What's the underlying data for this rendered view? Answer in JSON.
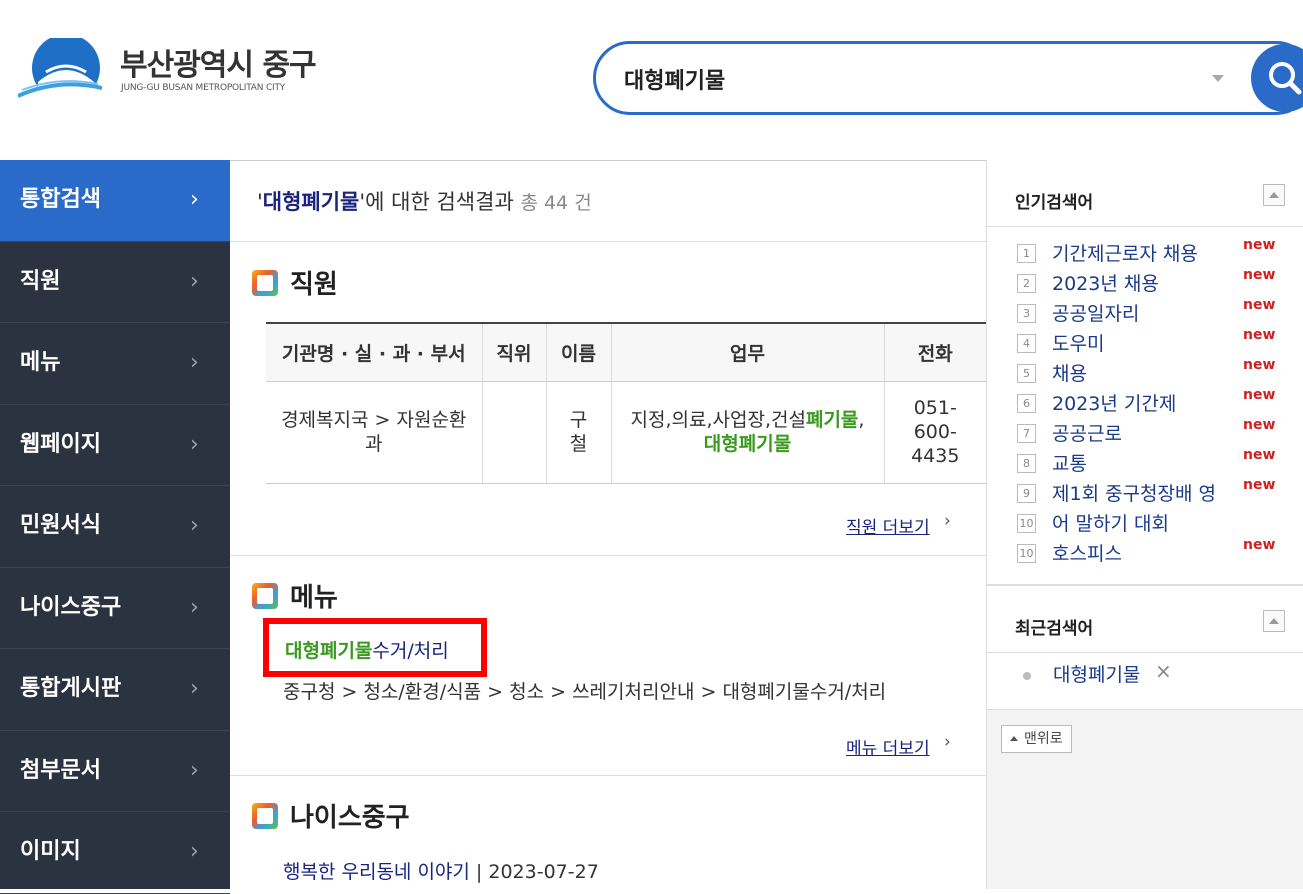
{
  "header": {
    "logo_title": "부산광역시 중구",
    "logo_subtitle": "JUNG-GU BUSAN METROPOLITAN CITY",
    "search_value": "대형폐기물",
    "search_icon": "search-icon"
  },
  "sidebar": {
    "items": [
      {
        "label": "통합검색",
        "active": true
      },
      {
        "label": "직원"
      },
      {
        "label": "메뉴"
      },
      {
        "label": "웹페이지"
      },
      {
        "label": "민원서식"
      },
      {
        "label": "나이스중구"
      },
      {
        "label": "통합게시판"
      },
      {
        "label": "첨부문서"
      },
      {
        "label": "이미지"
      }
    ],
    "chevron": "›"
  },
  "results": {
    "quote_open": "'",
    "keyword": "대형폐기물",
    "quote_close": "'",
    "suffix": "에 대한 검색결과",
    "count": "총 44 건"
  },
  "staff": {
    "title": "직원",
    "headers": [
      "기관명 · 실 · 과 · 부서",
      "직위",
      "이름",
      "업무",
      "전화"
    ],
    "row": {
      "dept": "경제복지국 > 자원순환과",
      "position": "",
      "name": "구철",
      "duty_plain": "지정,의료,사업장,건설",
      "duty_hl1": "폐기물",
      "duty_sep": ",",
      "duty_hl2": "대형폐기물",
      "phone": "051-600-4435"
    },
    "more": "직원 더보기"
  },
  "menu": {
    "title": "메뉴",
    "link_hl": "대형폐기물",
    "link_rest": "수거/처리",
    "path": "중구청 > 청소/환경/식품 > 청소 > 쓰레기처리안내 > 대형폐기물수거/처리",
    "more": "메뉴 더보기"
  },
  "nice": {
    "title": "나이스중구",
    "link": "행복한 우리동네 이야기",
    "sep": " | ",
    "date": "2023-07-27"
  },
  "popular": {
    "title": "인기검색어",
    "items": [
      {
        "num": "1",
        "text": "기간제근로자 채용",
        "badge": "new"
      },
      {
        "num": "2",
        "text": "2023년 채용",
        "badge": "new"
      },
      {
        "num": "3",
        "text": "공공일자리",
        "badge": "new"
      },
      {
        "num": "4",
        "text": "도우미",
        "badge": "new"
      },
      {
        "num": "5",
        "text": "채용",
        "badge": "new"
      },
      {
        "num": "6",
        "text": "2023년 기간제",
        "badge": "new"
      },
      {
        "num": "7",
        "text": "공공근로",
        "badge": "new"
      },
      {
        "num": "8",
        "text": "교통",
        "badge": "new"
      },
      {
        "num": "9",
        "text": "제1회 중구청장배 영",
        "badge": "new"
      },
      {
        "num": "10",
        "text": "어 말하기 대회",
        "badge": ""
      },
      {
        "num": "10",
        "text": "호스피스",
        "badge": "new"
      }
    ]
  },
  "recent": {
    "title": "최근검색어",
    "items": [
      {
        "text": "대형폐기물",
        "remove": "×"
      }
    ]
  },
  "top_button": "맨위로",
  "colors": {
    "accent": "#2a6ac8",
    "sidebar_bg": "#2b3340",
    "highlight": "#3a9a1f",
    "new_badge": "#d02020",
    "red_box": "#ff0000"
  }
}
